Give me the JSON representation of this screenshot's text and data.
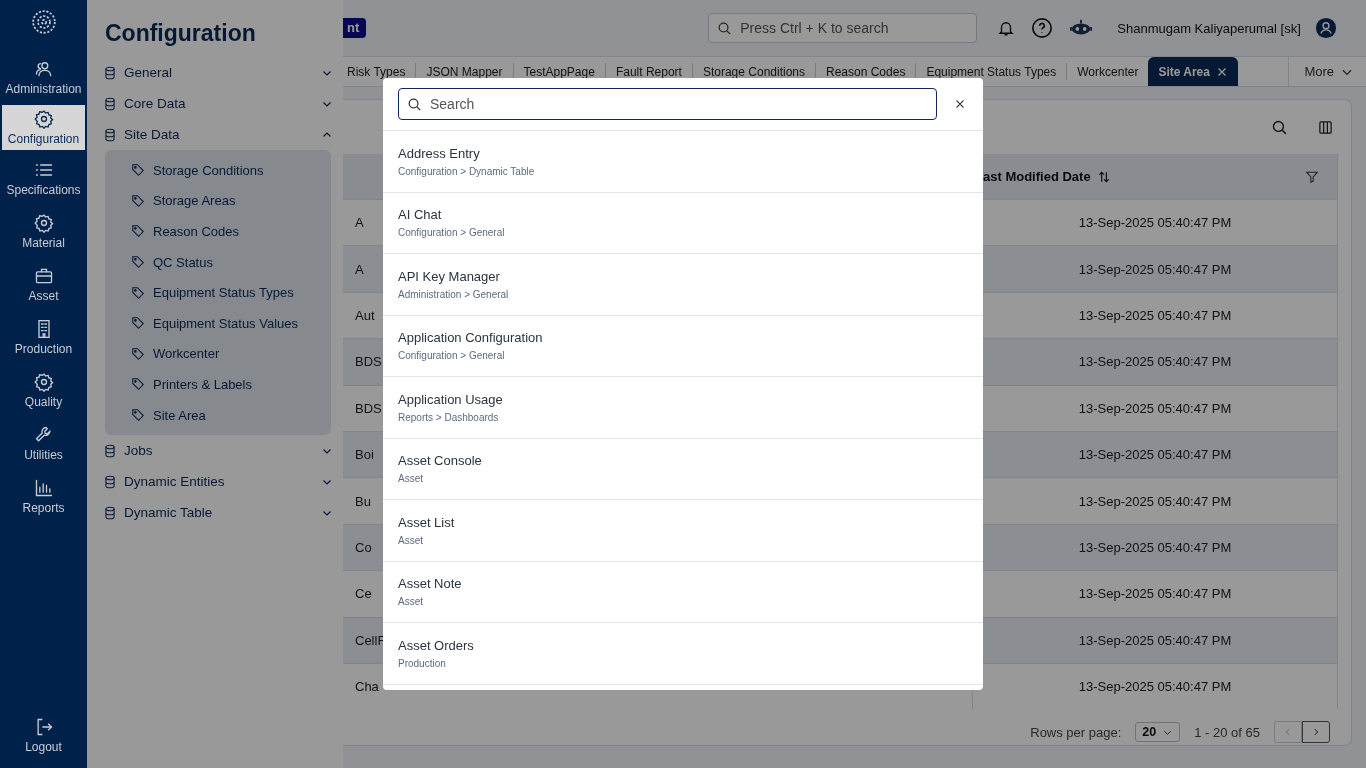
{
  "nav": {
    "items": [
      {
        "label": "Administration",
        "kind": "users",
        "selected": false
      },
      {
        "label": "Configuration",
        "kind": "gear",
        "selected": true
      },
      {
        "label": "Specifications",
        "kind": "list",
        "selected": false
      },
      {
        "label": "Material",
        "kind": "gear",
        "selected": false
      },
      {
        "label": "Asset",
        "kind": "briefcase",
        "selected": false
      },
      {
        "label": "Production",
        "kind": "building",
        "selected": false
      },
      {
        "label": "Quality",
        "kind": "gear",
        "selected": false
      },
      {
        "label": "Utilities",
        "kind": "wrench",
        "selected": false
      },
      {
        "label": "Reports",
        "kind": "chart",
        "selected": false
      }
    ],
    "logout": "Logout"
  },
  "config_panel": {
    "title": "Configuration",
    "groups": [
      {
        "label": "General",
        "expanded": false
      },
      {
        "label": "Core Data",
        "expanded": false
      },
      {
        "label": "Site Data",
        "expanded": true,
        "children": [
          "Storage Conditions",
          "Storage Areas",
          "Reason Codes",
          "QC Status",
          "Equipment Status Types",
          "Equipment Status Values",
          "Workcenter",
          "Printers & Labels",
          "Site Area"
        ]
      },
      {
        "label": "Jobs",
        "expanded": false
      },
      {
        "label": "Dynamic Entities",
        "expanded": false
      },
      {
        "label": "Dynamic Table",
        "expanded": false
      }
    ]
  },
  "header": {
    "badge": "nt",
    "search": {
      "placeholder": "Press Ctrl + K to search"
    },
    "user": "Shanmugam Kaliyaperumal [sk]"
  },
  "tabs": [
    {
      "label": "Risk Types",
      "selected": false
    },
    {
      "label": "JSON Mapper",
      "selected": false
    },
    {
      "label": "TestAppPage",
      "selected": false
    },
    {
      "label": "Fault Report",
      "selected": false
    },
    {
      "label": "Storage Conditions",
      "selected": false
    },
    {
      "label": "Reason Codes",
      "selected": false
    },
    {
      "label": "Equipment Status Types",
      "selected": false
    },
    {
      "label": "Workcenter",
      "selected": false
    },
    {
      "label": "Site Area",
      "selected": true
    }
  ],
  "more": "More",
  "table": {
    "column_3_header": "ast Modified Date",
    "rows": [
      {
        "column_1": "A",
        "column_3": "13-Sep-2025 05:40:47 PM"
      },
      {
        "column_1": "A",
        "column_3": "13-Sep-2025 05:40:47 PM"
      },
      {
        "column_1": "Aut",
        "column_3": "13-Sep-2025 05:40:47 PM"
      },
      {
        "column_1": "BDS",
        "column_3": "13-Sep-2025 05:40:47 PM"
      },
      {
        "column_1": "BDS",
        "column_3": "13-Sep-2025 05:40:47 PM"
      },
      {
        "column_1": "Boi",
        "column_3": "13-Sep-2025 05:40:47 PM"
      },
      {
        "column_1": "Bu",
        "column_3": "13-Sep-2025 05:40:47 PM"
      },
      {
        "column_1": "Co",
        "column_3": "13-Sep-2025 05:40:47 PM"
      },
      {
        "column_1": "Ce",
        "column_3": "13-Sep-2025 05:40:47 PM"
      },
      {
        "column_1": "CellF",
        "column_3": "13-Sep-2025 05:40:47 PM"
      },
      {
        "column_1": "Cha",
        "column_3": "13-Sep-2025 05:40:47 PM"
      }
    ]
  },
  "pagination": {
    "label": "Rows per page:",
    "page_size": "20",
    "range": "1 - 20 of 65"
  },
  "modal": {
    "search": {
      "placeholder": "Search"
    },
    "results": [
      {
        "title": "Address Entry",
        "path": "Configuration > Dynamic Table"
      },
      {
        "title": "AI Chat",
        "path": "Configuration > General"
      },
      {
        "title": "API Key Manager",
        "path": "Administration > General"
      },
      {
        "title": "Application Configuration",
        "path": "Configuration > General"
      },
      {
        "title": "Application Usage",
        "path": "Reports > Dashboards"
      },
      {
        "title": "Asset Console",
        "path": "Asset"
      },
      {
        "title": "Asset List",
        "path": "Asset"
      },
      {
        "title": "Asset Note",
        "path": "Asset"
      },
      {
        "title": "Asset Orders",
        "path": "Production"
      }
    ]
  }
}
